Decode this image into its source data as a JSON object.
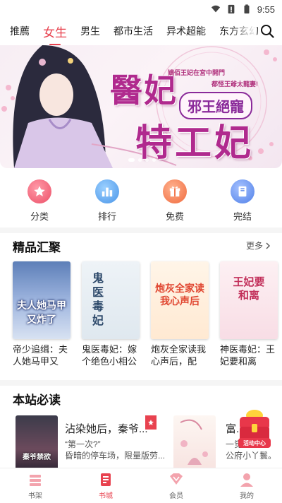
{
  "status_bar": {
    "time": "9:55"
  },
  "tabs": [
    {
      "label": "推薦"
    },
    {
      "label": "女生"
    },
    {
      "label": "男生"
    },
    {
      "label": "都市生活"
    },
    {
      "label": "异术超能"
    },
    {
      "label": "东方玄幻"
    }
  ],
  "banner": {
    "title_line1": "醫妃",
    "title_line2": "特工妃",
    "badge": "邪王絕寵",
    "tagline1": "嫡佰王妃在宮中開門",
    "tagline2": "都怪王爺太龍妻!",
    "slide_count": 4,
    "active_slide": 0
  },
  "quick_entries": [
    {
      "label": "分类",
      "icon": "star-icon",
      "color": "#f06477"
    },
    {
      "label": "排行",
      "icon": "ranking-icon",
      "color": "#5aa6ee"
    },
    {
      "label": "免费",
      "icon": "gift-icon",
      "color": "#f4794f"
    },
    {
      "label": "完结",
      "icon": "book-icon",
      "color": "#5b8ff0"
    }
  ],
  "featured": {
    "title": "精品汇聚",
    "more_label": "更多",
    "books": [
      {
        "name": "帝少追缉：夫人她马甲又炸...",
        "cover_text": "夫人她马甲又炸了"
      },
      {
        "name": "鬼医毒妃：嫁个绝色小相公",
        "cover_text": "鬼医毒妃"
      },
      {
        "name": "炮灰全家读我心声后，配角...",
        "cover_text": "炮灰全家读我心声后"
      },
      {
        "name": "神医毒妃：王妃要和离",
        "cover_text": "王妃要和离"
      }
    ]
  },
  "must_read": {
    "title": "本站必读",
    "items": [
      {
        "title": "沾染她后，秦爷...",
        "line1": "“第一次?”",
        "line2": "昏暗的停车场，限量版劳...",
        "cover_text": "秦爷禁欲"
      },
      {
        "title": "富...",
        "line1": "一觉...",
        "line2": "公府小丫鬟。"
      }
    ],
    "promo_label": "活动中心"
  },
  "bottom_nav": [
    {
      "label": "书架",
      "icon": "bookshelf-icon"
    },
    {
      "label": "书城",
      "icon": "bookstore-icon",
      "active": true
    },
    {
      "label": "会员",
      "icon": "vip-icon"
    },
    {
      "label": "我的",
      "icon": "profile-icon"
    }
  ]
}
